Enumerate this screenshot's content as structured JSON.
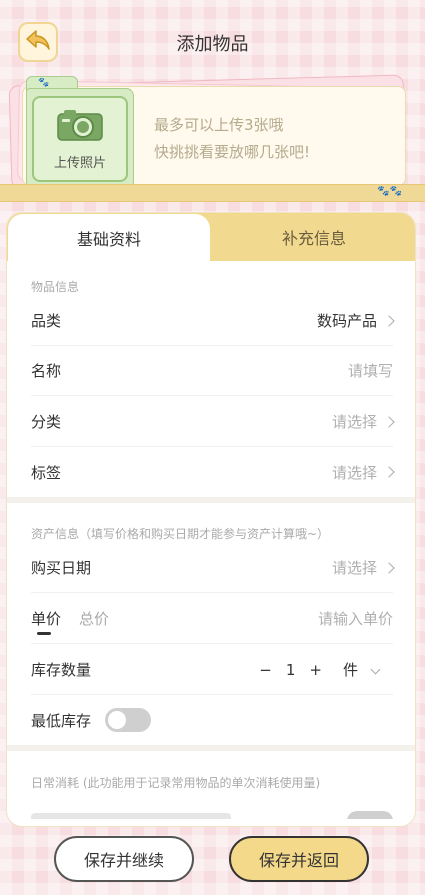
{
  "header": {
    "title": "添加物品",
    "back_icon": "back-arrow-icon"
  },
  "upload": {
    "button_label": "上传照片",
    "hint_line1": "最多可以上传3张哦",
    "hint_line2": "快挑挑看要放哪几张吧!"
  },
  "tabs": [
    {
      "label": "基础资料"
    },
    {
      "label": "补充信息"
    }
  ],
  "sections": {
    "item_info": "物品信息",
    "asset_info": "资产信息（填写价格和购买日期才能参与资产计算哦~）",
    "daily": "日常消耗 (此功能用于记录常用物品的单次消耗使用量)"
  },
  "rows": {
    "category": {
      "label": "品类",
      "value": "数码产品"
    },
    "name": {
      "label": "名称",
      "value": "请填写"
    },
    "classify": {
      "label": "分类",
      "value": "请选择"
    },
    "tag": {
      "label": "标签",
      "value": "请选择"
    },
    "purchase_date": {
      "label": "购买日期",
      "value": "请选择"
    },
    "price": {
      "tab_unit": "单价",
      "tab_total": "总价",
      "placeholder": "请输入单价"
    },
    "stock": {
      "label": "库存数量",
      "minus": "−",
      "qty": "1",
      "plus": "+",
      "unit": "件"
    },
    "min_stock": {
      "label": "最低库存"
    }
  },
  "buttons": {
    "save_continue": "保存并继续",
    "save_return": "保存并返回"
  },
  "colors": {
    "accent": "#f4d98a",
    "folder_green": "#d7ebc4",
    "background_pink": "#f8dde0"
  }
}
